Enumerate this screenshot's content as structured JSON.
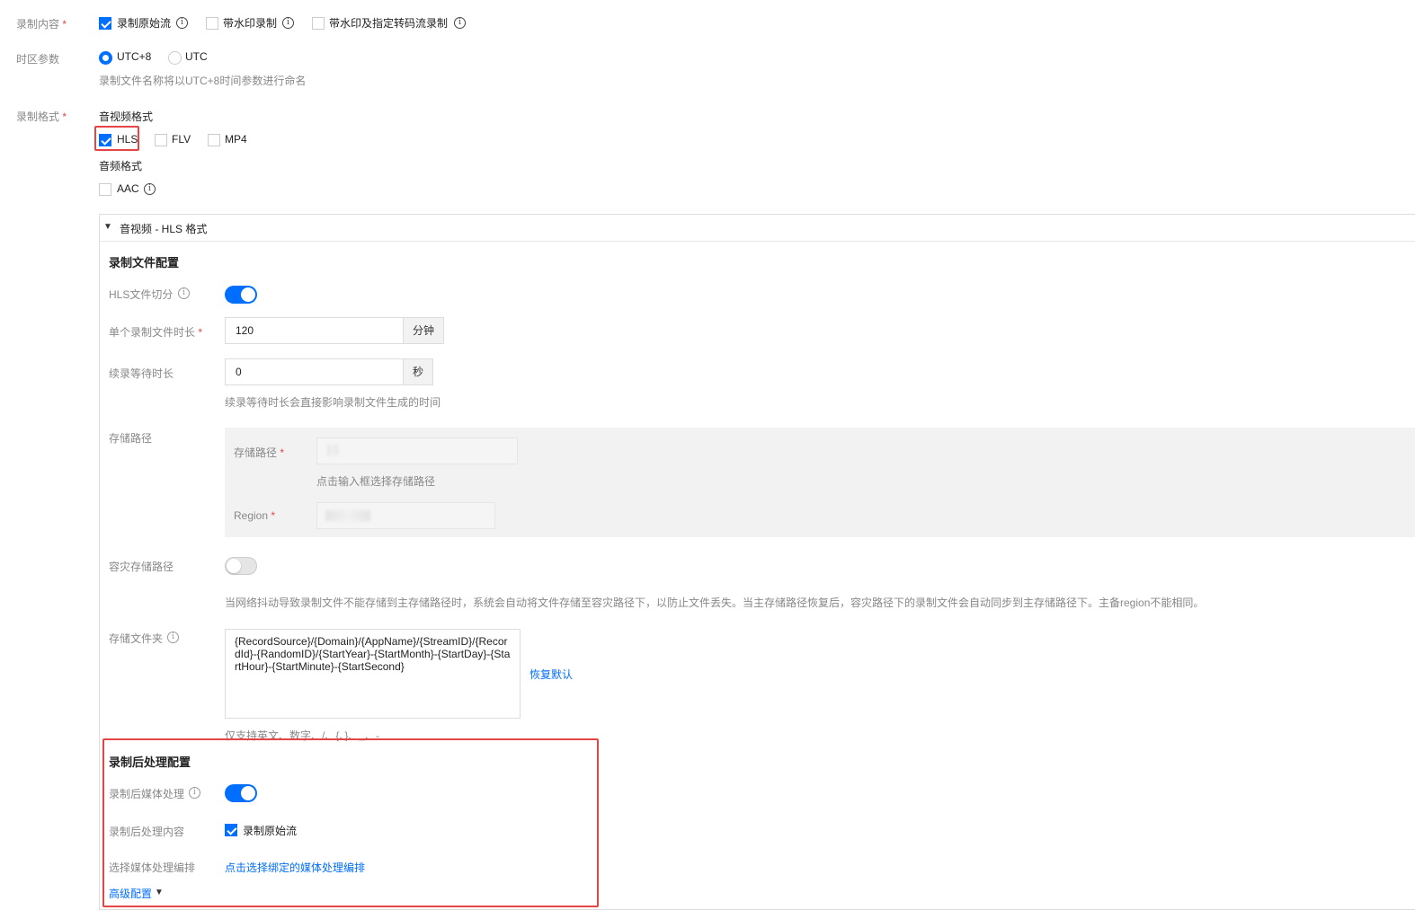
{
  "colors": {
    "accent": "#006eff",
    "required": "#e54545",
    "panel_bg": "#f2f2f2"
  },
  "record_content": {
    "label": "录制内容",
    "options": [
      "录制原始流",
      "带水印录制",
      "带水印及指定转码流录制"
    ],
    "checked": [
      true,
      false,
      false
    ]
  },
  "timezone": {
    "label": "时区参数",
    "options": [
      "UTC+8",
      "UTC"
    ],
    "selected": "UTC+8",
    "hint": "录制文件名称将以UTC+8时间参数进行命名"
  },
  "record_format": {
    "label": "录制格式",
    "av_title": "音视频格式",
    "av_options": [
      "HLS",
      "FLV",
      "MP4"
    ],
    "av_checked": [
      true,
      false,
      false
    ],
    "audio_title": "音频格式",
    "audio_options": [
      "AAC"
    ],
    "audio_checked": [
      false
    ]
  },
  "hls_panel": {
    "header": "音视频 - HLS 格式",
    "file_config_title": "录制文件配置",
    "hls_split_label": "HLS文件切分",
    "hls_split_on": true,
    "duration_label": "单个录制文件时长",
    "duration_value": "120",
    "duration_unit": "分钟",
    "wait_label": "续录等待时长",
    "wait_value": "0",
    "wait_unit": "秒",
    "wait_hint": "续录等待时长会直接影响录制文件生成的时间",
    "storage_label": "存储路径",
    "storage_path_label": "存储路径",
    "storage_path_hint": "点击输入框选择存储路径",
    "region_label": "Region",
    "backup_label": "容灾存储路径",
    "backup_on": false,
    "backup_hint": "当网络抖动导致录制文件不能存储到主存储路径时，系统会自动将文件存储至容灾路径下，以防止文件丢失。当主存储路径恢复后，容灾路径下的录制文件会自动同步到主存储路径下。主备region不能相同。",
    "folder_label": "存储文件夹",
    "folder_value": "{RecordSource}/{Domain}/{AppName}/{StreamID}/{RecordId}-{RandomID}/{StartYear}-{StartMonth}-{StartDay}-{StartHour}-{StartMinute}-{StartSecond}",
    "folder_reset": "恢复默认",
    "folder_hint": "仅支持英文、数字、/、{、}、_、-"
  },
  "post_process": {
    "title": "录制后处理配置",
    "media_label": "录制后媒体处理",
    "media_on": true,
    "content_label": "录制后处理内容",
    "content_option": "录制原始流",
    "content_checked": true,
    "orchestration_label": "选择媒体处理编排",
    "orchestration_link": "点击选择绑定的媒体处理编排",
    "advanced": "高级配置"
  }
}
